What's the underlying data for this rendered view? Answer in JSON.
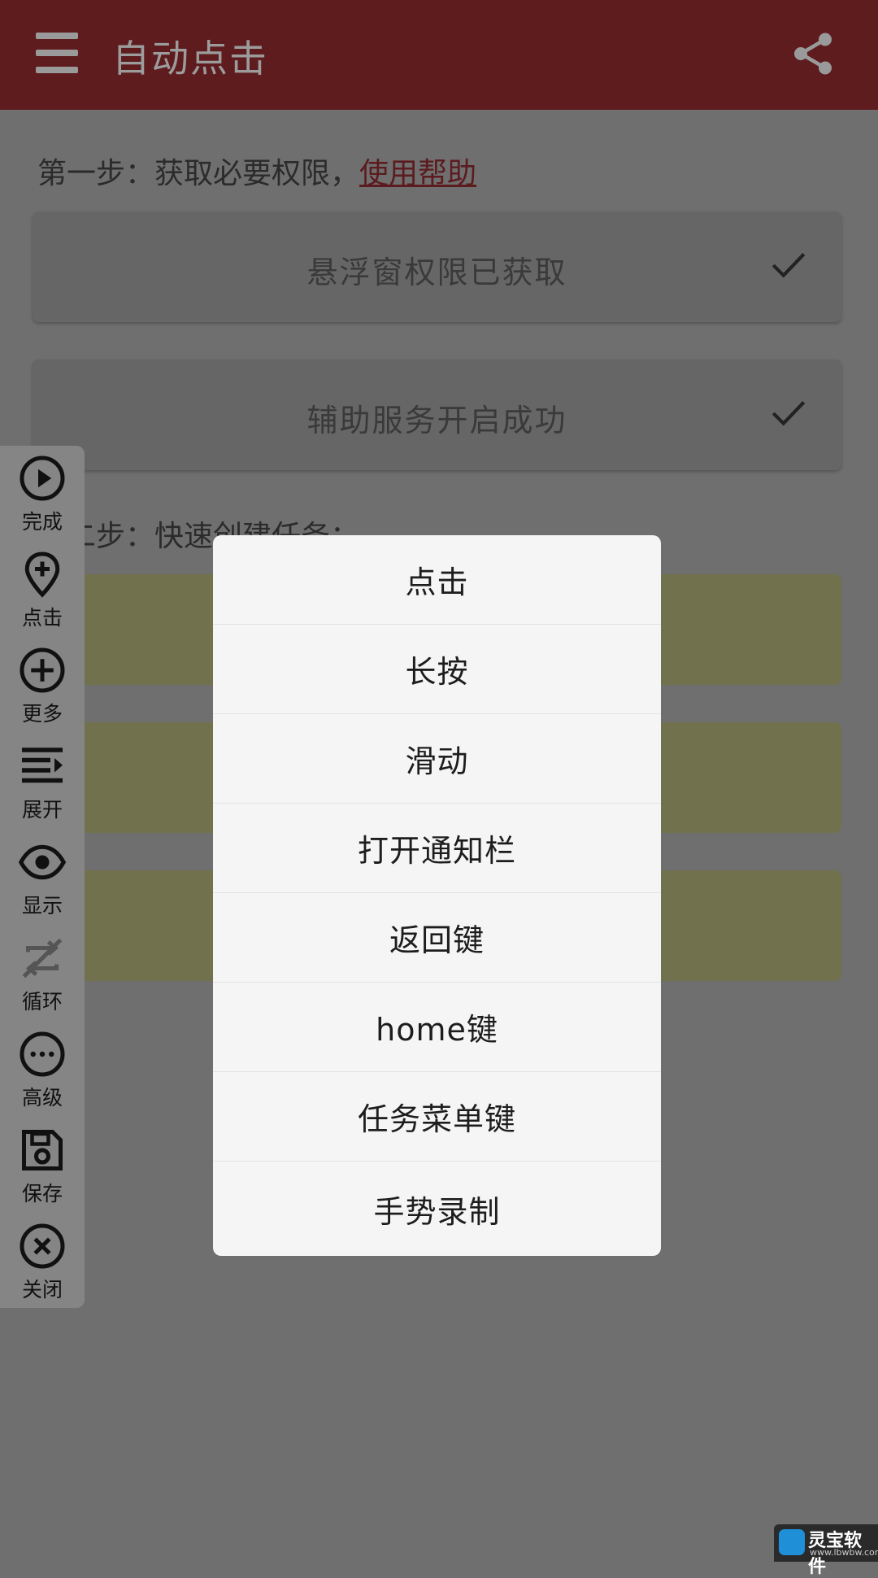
{
  "appbar": {
    "title": "自动点击"
  },
  "step1": {
    "prefix": "第一步：获取必要权限，",
    "help_link": "使用帮助"
  },
  "permissions": [
    {
      "label": "悬浮窗权限已获取"
    },
    {
      "label": "辅助服务开启成功"
    }
  ],
  "step2": {
    "text": "第二步：快速创建任务："
  },
  "toolbar": {
    "items": [
      {
        "label": "完成",
        "icon": "play-circle-icon"
      },
      {
        "label": "点击",
        "icon": "add-location-icon"
      },
      {
        "label": "更多",
        "icon": "add-circle-icon"
      },
      {
        "label": "展开",
        "icon": "list-expand-icon"
      },
      {
        "label": "显示",
        "icon": "eye-icon"
      },
      {
        "label": "循环",
        "icon": "repeat-off-icon"
      },
      {
        "label": "高级",
        "icon": "more-circle-icon"
      },
      {
        "label": "保存",
        "icon": "save-icon"
      },
      {
        "label": "关闭",
        "icon": "close-circle-icon"
      }
    ]
  },
  "dialog": {
    "items": [
      "点击",
      "长按",
      "滑动",
      "打开通知栏",
      "返回键",
      "home键",
      "任务菜单键",
      "手势录制"
    ]
  },
  "watermark": {
    "text": "灵宝软件",
    "url": "www.lbwbw.com"
  },
  "colors": {
    "appbar": "#5e1c1f",
    "dim": "#6f6f6f",
    "dialog": "#f5f5f5",
    "task_card": "#71724d"
  }
}
